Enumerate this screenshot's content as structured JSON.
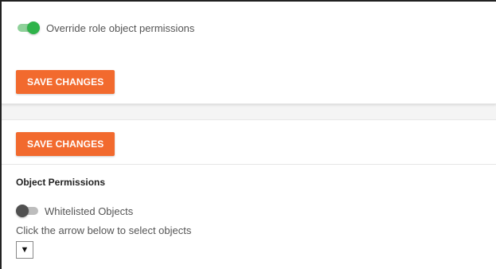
{
  "override_section": {
    "toggle_label": "Override role object permissions",
    "toggle_state": "on",
    "save_label": "SAVE CHANGES"
  },
  "permissions_section": {
    "save_label": "SAVE CHANGES",
    "title": "Object Permissions",
    "whitelist_toggle_label": "Whitelisted Objects",
    "whitelist_toggle_state": "off",
    "hint": "Click the arrow below to select objects",
    "dropdown_icon": "▼"
  },
  "colors": {
    "accent_button": "#f26a2e",
    "toggle_on": "#2fb34a",
    "toggle_off": "#505050"
  },
  "icons": {
    "dropdown": "triangle-down-icon"
  }
}
